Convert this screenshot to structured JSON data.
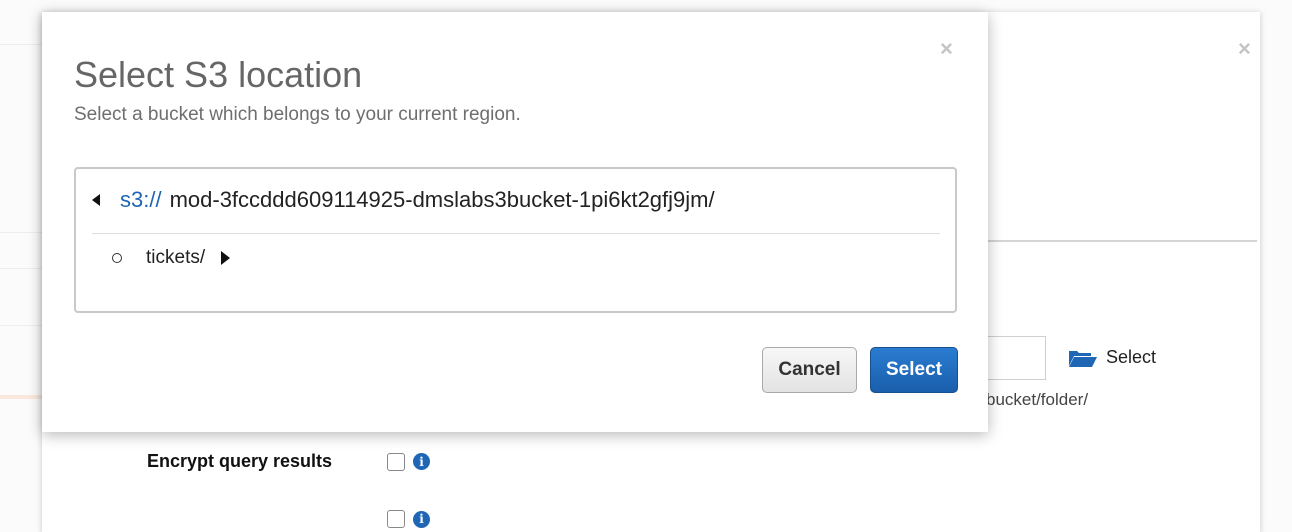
{
  "background": {
    "close_glyph": "×",
    "folder_icon": "folder-open-icon",
    "select_label": "Select",
    "path_hint": "bucket/folder/",
    "options": [
      {
        "label": "Encrypt query results"
      }
    ]
  },
  "modal": {
    "close_glyph": "×",
    "title": "Select S3 location",
    "subtitle": "Select a bucket which belongs to your current region.",
    "path": {
      "prefix": "s3://",
      "bucket": "mod-3fccddd609114925-dmslabs3bucket-1pi6kt2gfj9jm/"
    },
    "items": [
      {
        "name": "tickets/"
      }
    ],
    "cancel_label": "Cancel",
    "select_label": "Select"
  },
  "colors": {
    "link_blue": "#1e66b3",
    "primary_button": "#1a5fab"
  }
}
